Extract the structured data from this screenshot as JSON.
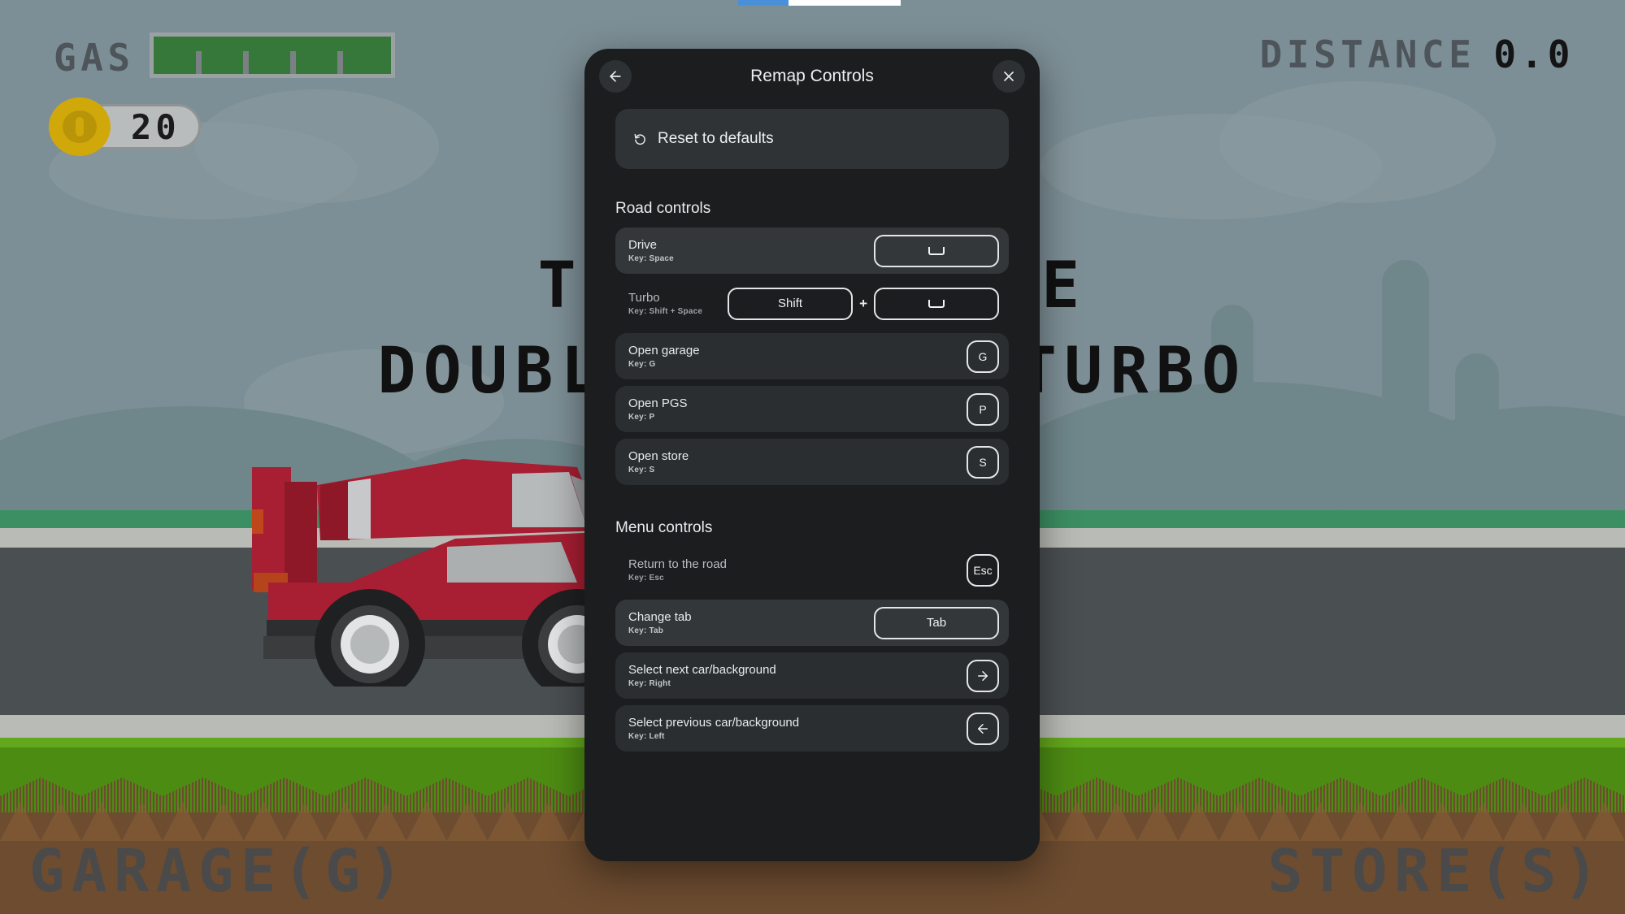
{
  "game": {
    "hud": {
      "gas_label": "GAS",
      "gas_percent": 100,
      "coin_amount": "20",
      "distance_label": "DISTANCE",
      "distance_value": "0.0"
    },
    "prompt": {
      "line1": "TAP TO DRIVE",
      "line2": "DOUBLE TAP TO TURBO"
    },
    "nav": {
      "garage_label": "GARAGE(G)",
      "store_label": "STORE(S)"
    },
    "colors": {
      "sky": "#7d8f96",
      "hill": "#6f878b",
      "grass_far": "#3c8f62",
      "road": "#4a4f52",
      "curb": "#b9bbb6",
      "grass_near": "#4d8c13",
      "dirt": "#6d4c30",
      "car_body": "#a81e32",
      "gas_fill": "#35783a",
      "coin": "#d1a80a"
    }
  },
  "loading_bar": {
    "accent": "#4a90d9",
    "track": "#ffffff"
  },
  "modal": {
    "title": "Remap Controls",
    "back_icon": "arrow-left-icon",
    "close_icon": "close-icon",
    "reset": {
      "icon": "rotate-ccw-icon",
      "label": "Reset to defaults"
    },
    "sections": [
      {
        "title": "Road controls",
        "rows": [
          {
            "name": "Drive",
            "key_label": "Key: Space",
            "style": "bright",
            "keys": [
              {
                "type": "space",
                "label": ""
              }
            ]
          },
          {
            "name": "Turbo",
            "key_label": "Key: Shift + Space",
            "style": "plain",
            "keys": [
              {
                "type": "wide",
                "label": "Shift"
              },
              {
                "type": "plus",
                "label": "+"
              },
              {
                "type": "space",
                "label": ""
              }
            ]
          },
          {
            "name": "Open garage",
            "key_label": "Key: G",
            "style": "normal",
            "keys": [
              {
                "type": "sq",
                "label": "G"
              }
            ]
          },
          {
            "name": "Open PGS",
            "key_label": "Key: P",
            "style": "normal",
            "keys": [
              {
                "type": "sq",
                "label": "P"
              }
            ]
          },
          {
            "name": "Open store",
            "key_label": "Key: S",
            "style": "normal",
            "keys": [
              {
                "type": "sq",
                "label": "S"
              }
            ]
          }
        ]
      },
      {
        "title": "Menu controls",
        "rows": [
          {
            "name": "Return to the road",
            "key_label": "Key: Esc",
            "style": "plain",
            "keys": [
              {
                "type": "sq",
                "label": "Esc"
              }
            ]
          },
          {
            "name": "Change tab",
            "key_label": "Key: Tab",
            "style": "bright",
            "keys": [
              {
                "type": "wide",
                "label": "Tab"
              }
            ]
          },
          {
            "name": "Select next car/background",
            "key_label": "Key: Right",
            "style": "normal",
            "keys": [
              {
                "type": "sq",
                "label": "",
                "icon": "arrow-right-icon"
              }
            ]
          },
          {
            "name": "Select previous car/background",
            "key_label": "Key: Left",
            "style": "normal",
            "keys": [
              {
                "type": "sq",
                "label": "",
                "icon": "arrow-left-icon"
              }
            ]
          }
        ]
      }
    ]
  }
}
